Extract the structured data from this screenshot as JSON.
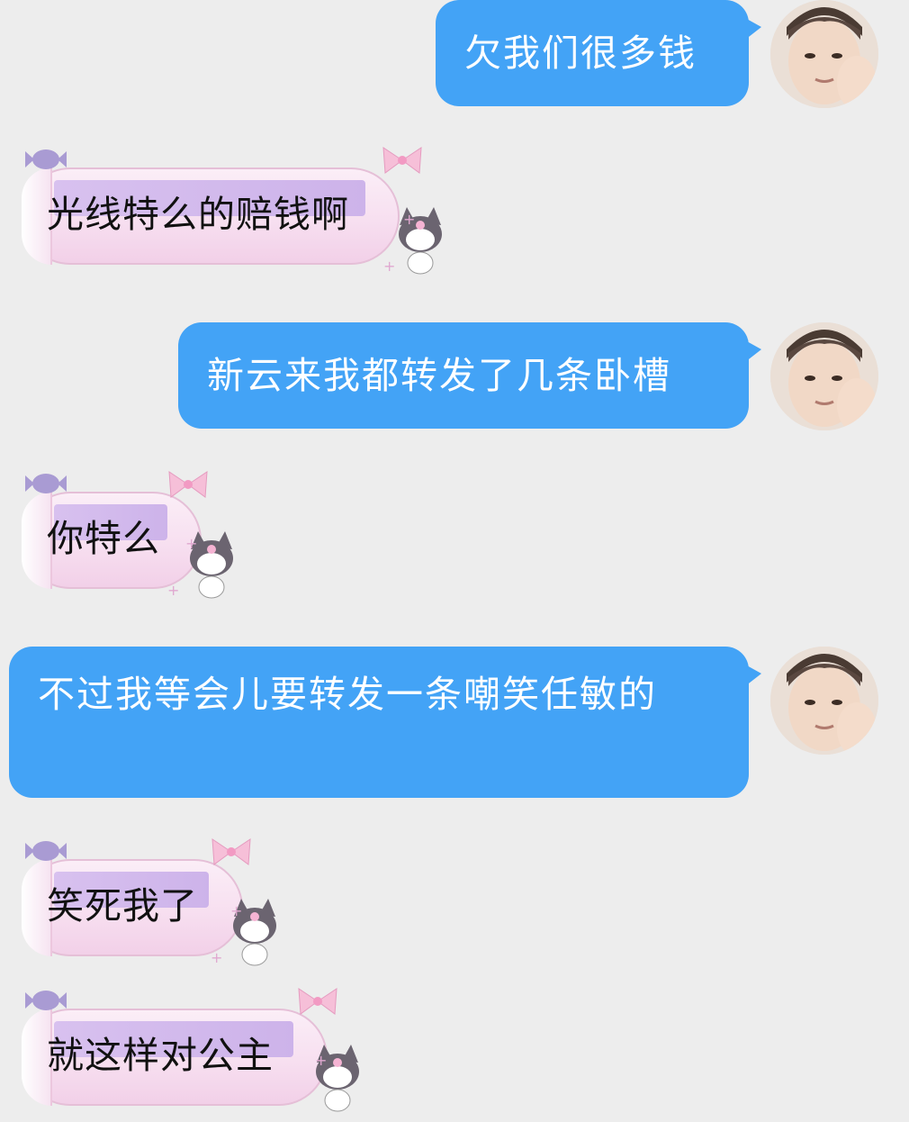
{
  "messages": [
    {
      "side": "out",
      "text": "欠我们很多钱"
    },
    {
      "side": "in",
      "text": "光线特么的赔钱啊"
    },
    {
      "side": "out",
      "text": "新云来我都转发了几条卧槽"
    },
    {
      "side": "in",
      "text": "你特么"
    },
    {
      "side": "out",
      "text": "不过我等会儿要转发一条嘲笑任敏的"
    },
    {
      "side": "in",
      "text": "笑死我了"
    },
    {
      "side": "in",
      "text": "就这样对公主"
    }
  ],
  "colors": {
    "background": "#ededed",
    "outgoing_bubble": "#43a3f6",
    "outgoing_text": "#ffffff",
    "incoming_text": "#111111"
  },
  "icons": {
    "avatar": "user-avatar-photo",
    "candy_bubble_decoration": "kuromi-candy-icon"
  }
}
